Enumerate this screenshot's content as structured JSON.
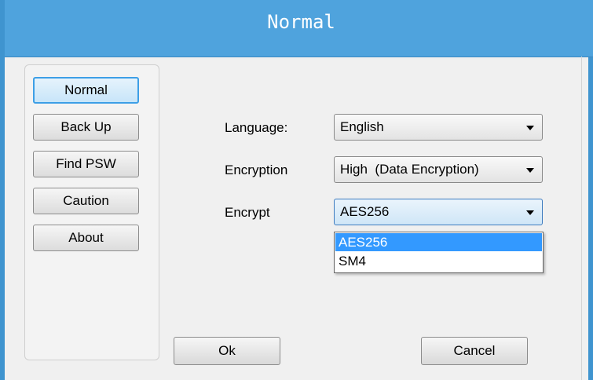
{
  "window": {
    "title": "Normal"
  },
  "sidebar": {
    "items": [
      {
        "label": "Normal",
        "active": true
      },
      {
        "label": "Back Up"
      },
      {
        "label": "Find PSW"
      },
      {
        "label": "Caution"
      },
      {
        "label": "About"
      }
    ]
  },
  "settings": {
    "language": {
      "label": "Language:",
      "value": "English"
    },
    "encryption": {
      "label": "Encryption",
      "value": "High  (Data Encryption)"
    },
    "encrypt": {
      "label": "Encrypt",
      "value": "AES256",
      "options": [
        "AES256",
        "SM4"
      ],
      "highlighted": "AES256"
    }
  },
  "footer": {
    "ok_label": "Ok",
    "cancel_label": "Cancel"
  },
  "colors": {
    "titlebar": "#4fa3dd",
    "highlight": "#3399ff",
    "active_border": "#3d9fe6"
  }
}
